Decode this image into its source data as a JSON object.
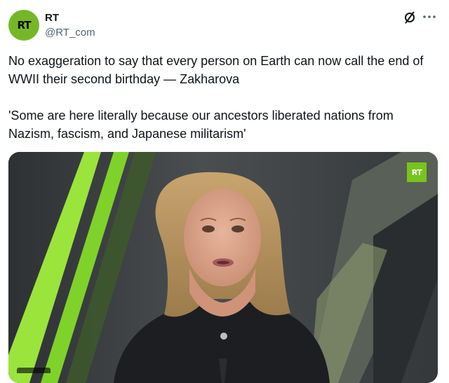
{
  "author": {
    "name": "RT",
    "handle": "@RT_com",
    "avatar_text": "RT",
    "avatar_color": "#76b72a"
  },
  "header_icons": [
    "grok-icon",
    "more-icon"
  ],
  "tweet": {
    "paragraphs": [
      "No exaggeration to say that every person on Earth can now call the end of WWII their second birthday — Zakharova",
      "'Some are here literally because our ancestors liberated nations from Nazism, fascism, and Japanese militarism'"
    ]
  },
  "media": {
    "type": "video",
    "logo_text": "RT",
    "logo_color": "#78c31c"
  },
  "colors": {
    "text": "#0f1419",
    "secondary": "#536471",
    "stripe_green": "#8ee03a"
  }
}
